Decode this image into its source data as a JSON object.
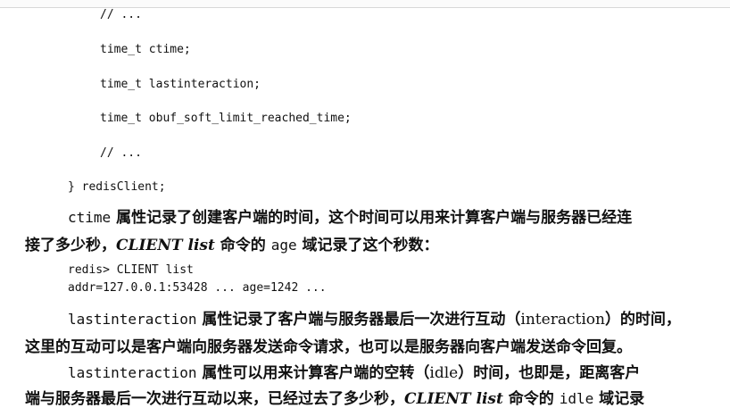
{
  "code_block_1": {
    "lines": [
      "// ...",
      "time_t ctime;",
      "time_t lastinteraction;",
      "time_t obuf_soft_limit_reached_time;",
      "// ...",
      "} redisClient;"
    ]
  },
  "paragraph_1": {
    "code": "ctime",
    "text_a": " 属性记录了创建客户端的时间，这个时间可以用来计算客户端与服务器已经连",
    "text_b": "接了多少秒，",
    "cmd": "CLIENT list",
    "text_c": " 命令的 ",
    "field": "age",
    "text_d": " 域记录了这个秒数："
  },
  "code_block_2": {
    "lines": [
      "redis> CLIENT list",
      "addr=127.0.0.1:53428 ... age=1242 ..."
    ]
  },
  "paragraph_2": {
    "code": "lastinteraction",
    "text_a": " 属性记录了客户端与服务器最后一次进行互动（",
    "term": "interaction",
    "text_b": "）的时间，",
    "text_c": "这里的互动可以是客户端向服务器发送命令请求，也可以是服务器向客户端发送命令回复。"
  },
  "paragraph_3": {
    "code": "lastinteraction",
    "text_a": " 属性可以用来计算客户端的空转（",
    "term": "idle",
    "text_b": "）时间，也即是，距离客户",
    "text_c": "端与服务器最后一次进行互动以来，已经过去了多少秒，",
    "cmd": "CLIENT list",
    "text_d": " 命令的 ",
    "field": "idle",
    "text_e": " 域记录"
  }
}
